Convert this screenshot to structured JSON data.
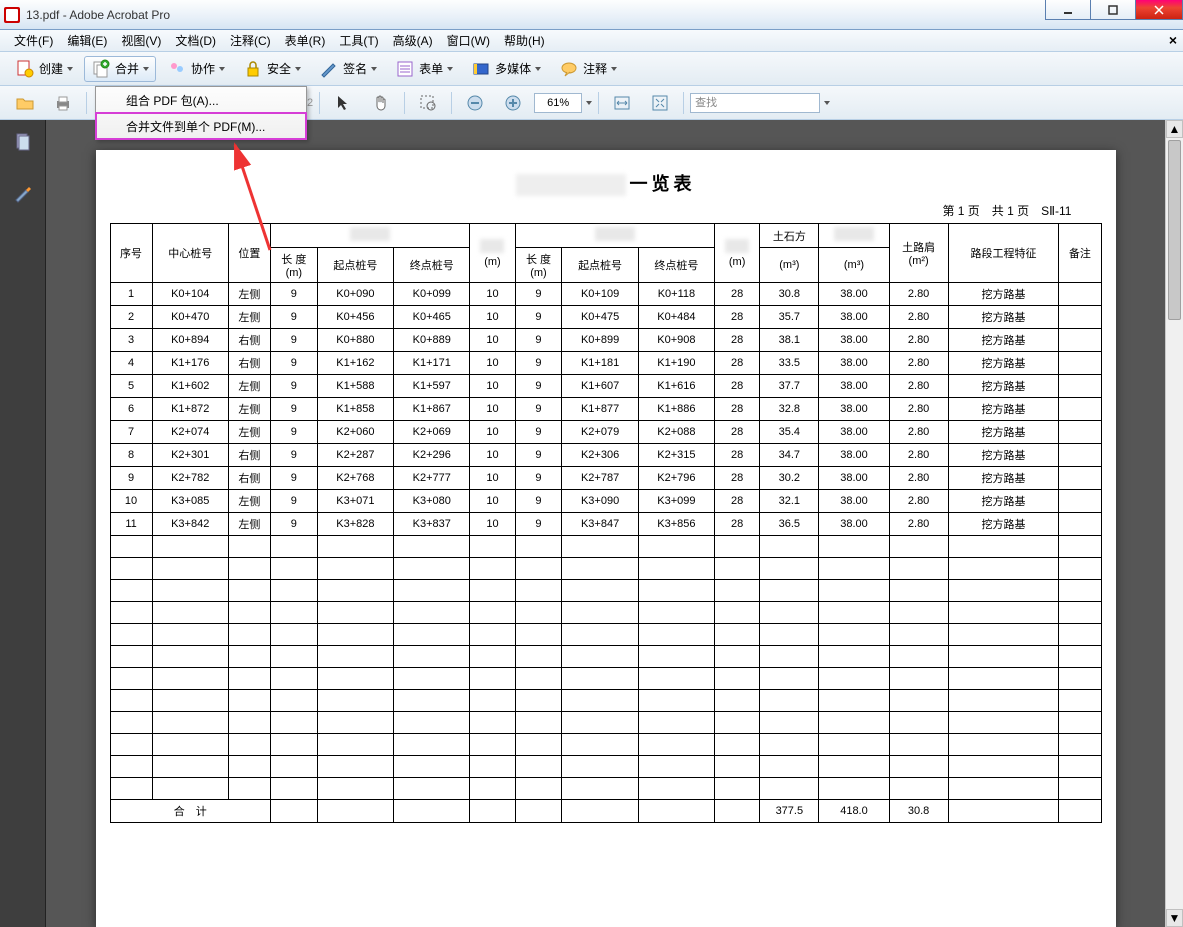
{
  "window": {
    "title": "13.pdf - Adobe Acrobat Pro"
  },
  "menubar": {
    "items": [
      "文件(F)",
      "编辑(E)",
      "视图(V)",
      "文档(D)",
      "注释(C)",
      "表单(R)",
      "工具(T)",
      "高级(A)",
      "窗口(W)",
      "帮助(H)"
    ]
  },
  "toolbar1": {
    "create": "创建",
    "combine": "合并",
    "collab": "协作",
    "secure": "安全",
    "sign": "签名",
    "forms": "表单",
    "multimedia": "多媒体",
    "comment": "注释"
  },
  "toolbar2": {
    "zoom": "61%",
    "search_placeholder": "查找"
  },
  "dropdown": {
    "item1": "组合 PDF 包(A)...",
    "item2": "合并文件到单个 PDF(M)..."
  },
  "doc": {
    "title_suffix": "一览表",
    "page_info": "第 1 页　共 1 页　SⅡ-11",
    "headers": {
      "seq": "序号",
      "center_pile": "中心桩号",
      "position": "位置",
      "length_m": "长 度\n(m)",
      "start_pile": "起点桩号",
      "end_pile": "终点桩号",
      "m": "(m)",
      "earth": "土石方",
      "m3": "(m³)",
      "shoulder": "土路肩\n(m²)",
      "feature": "路段工程特征",
      "remark": "备注"
    },
    "rows": [
      {
        "seq": "1",
        "pile": "K0+104",
        "pos": "左侧",
        "len": "9",
        "sp": "K0+090",
        "ep": "K0+099",
        "m1": "10",
        "len2": "9",
        "sp2": "K0+109",
        "ep2": "K0+118",
        "m2": "28",
        "earth": "30.8",
        "m3": "38.00",
        "shoulder": "2.80",
        "feat": "挖方路基"
      },
      {
        "seq": "2",
        "pile": "K0+470",
        "pos": "左侧",
        "len": "9",
        "sp": "K0+456",
        "ep": "K0+465",
        "m1": "10",
        "len2": "9",
        "sp2": "K0+475",
        "ep2": "K0+484",
        "m2": "28",
        "earth": "35.7",
        "m3": "38.00",
        "shoulder": "2.80",
        "feat": "挖方路基"
      },
      {
        "seq": "3",
        "pile": "K0+894",
        "pos": "右侧",
        "len": "9",
        "sp": "K0+880",
        "ep": "K0+889",
        "m1": "10",
        "len2": "9",
        "sp2": "K0+899",
        "ep2": "K0+908",
        "m2": "28",
        "earth": "38.1",
        "m3": "38.00",
        "shoulder": "2.80",
        "feat": "挖方路基"
      },
      {
        "seq": "4",
        "pile": "K1+176",
        "pos": "右侧",
        "len": "9",
        "sp": "K1+162",
        "ep": "K1+171",
        "m1": "10",
        "len2": "9",
        "sp2": "K1+181",
        "ep2": "K1+190",
        "m2": "28",
        "earth": "33.5",
        "m3": "38.00",
        "shoulder": "2.80",
        "feat": "挖方路基"
      },
      {
        "seq": "5",
        "pile": "K1+602",
        "pos": "左侧",
        "len": "9",
        "sp": "K1+588",
        "ep": "K1+597",
        "m1": "10",
        "len2": "9",
        "sp2": "K1+607",
        "ep2": "K1+616",
        "m2": "28",
        "earth": "37.7",
        "m3": "38.00",
        "shoulder": "2.80",
        "feat": "挖方路基"
      },
      {
        "seq": "6",
        "pile": "K1+872",
        "pos": "左侧",
        "len": "9",
        "sp": "K1+858",
        "ep": "K1+867",
        "m1": "10",
        "len2": "9",
        "sp2": "K1+877",
        "ep2": "K1+886",
        "m2": "28",
        "earth": "32.8",
        "m3": "38.00",
        "shoulder": "2.80",
        "feat": "挖方路基"
      },
      {
        "seq": "7",
        "pile": "K2+074",
        "pos": "左侧",
        "len": "9",
        "sp": "K2+060",
        "ep": "K2+069",
        "m1": "10",
        "len2": "9",
        "sp2": "K2+079",
        "ep2": "K2+088",
        "m2": "28",
        "earth": "35.4",
        "m3": "38.00",
        "shoulder": "2.80",
        "feat": "挖方路基"
      },
      {
        "seq": "8",
        "pile": "K2+301",
        "pos": "右侧",
        "len": "9",
        "sp": "K2+287",
        "ep": "K2+296",
        "m1": "10",
        "len2": "9",
        "sp2": "K2+306",
        "ep2": "K2+315",
        "m2": "28",
        "earth": "34.7",
        "m3": "38.00",
        "shoulder": "2.80",
        "feat": "挖方路基"
      },
      {
        "seq": "9",
        "pile": "K2+782",
        "pos": "右侧",
        "len": "9",
        "sp": "K2+768",
        "ep": "K2+777",
        "m1": "10",
        "len2": "9",
        "sp2": "K2+787",
        "ep2": "K2+796",
        "m2": "28",
        "earth": "30.2",
        "m3": "38.00",
        "shoulder": "2.80",
        "feat": "挖方路基"
      },
      {
        "seq": "10",
        "pile": "K3+085",
        "pos": "左侧",
        "len": "9",
        "sp": "K3+071",
        "ep": "K3+080",
        "m1": "10",
        "len2": "9",
        "sp2": "K3+090",
        "ep2": "K3+099",
        "m2": "28",
        "earth": "32.1",
        "m3": "38.00",
        "shoulder": "2.80",
        "feat": "挖方路基"
      },
      {
        "seq": "11",
        "pile": "K3+842",
        "pos": "左侧",
        "len": "9",
        "sp": "K3+828",
        "ep": "K3+837",
        "m1": "10",
        "len2": "9",
        "sp2": "K3+847",
        "ep2": "K3+856",
        "m2": "28",
        "earth": "36.5",
        "m3": "38.00",
        "shoulder": "2.80",
        "feat": "挖方路基"
      }
    ],
    "totals": {
      "label": "合　计",
      "earth": "377.5",
      "m3": "418.0",
      "shoulder": "30.8"
    }
  }
}
